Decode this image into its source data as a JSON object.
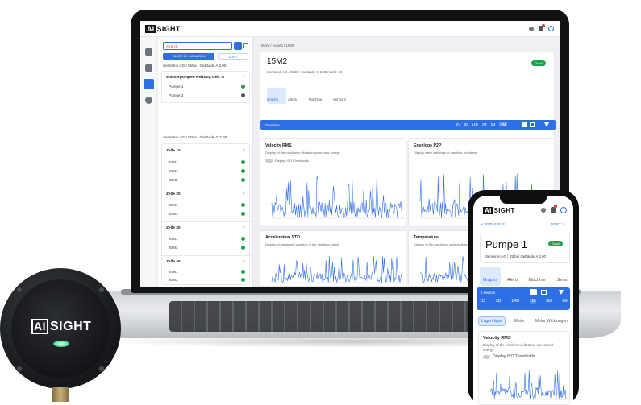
{
  "laptop": {
    "logo_box": "AI",
    "logo_text": "SIGHT",
    "sidebar": {
      "search_placeholder": "Search",
      "filter_location": "FILTER BY LOCATION",
      "sort": "SORT",
      "location1": "Senssron AG / Stäfa / Gebäude A 3.00",
      "group1_title": "Wasserpumpen Heizung Geb. A",
      "group1_items": [
        "Pumpe 1",
        "Pumpe 2"
      ],
      "location2": "Senssron AG / Stäfa / Gebäude C 2.00",
      "zones": [
        {
          "title": "Zelle 10",
          "items": [
            "20M1",
            "20M3",
            "20M5"
          ]
        },
        {
          "title": "Zelle 20",
          "items": [
            "20M1",
            "20M3"
          ]
        },
        {
          "title": "Zelle 30",
          "items": [
            "20M1",
            "20M3"
          ]
        },
        {
          "title": "Zelle 40",
          "items": [
            "20M1",
            "20M3"
          ]
        }
      ]
    },
    "main": {
      "breadcrumb": "Work / Assets / 15M2",
      "asset_title": "15M2",
      "asset_sub": "Senssron AG / Stäfa / Gebäude C 2.00 / Zelle 10",
      "status": "Good",
      "tabs": [
        "Graphs",
        "Alerts",
        "Machine",
        "Sensors"
      ],
      "bar_label": "Overview",
      "ranges": [
        "1h",
        "3D",
        "14D",
        "1M",
        "3M",
        "6M"
      ],
      "charts": [
        {
          "title": "Velocity RMS",
          "sub": "Display of the machine's vibration speed and energy",
          "toggle": "Display ISO Thresholds"
        },
        {
          "title": "Envelope P2P",
          "sub": "Display early warnings of machine problems"
        },
        {
          "title": "Acceleration STD",
          "sub": "Display of measured variation in the vibration signal"
        },
        {
          "title": "Temperature",
          "sub": "Display of the machine's surface temperature"
        }
      ]
    }
  },
  "sensor": {
    "logo_box": "AI",
    "logo_text": "SIGHT"
  },
  "phone": {
    "logo_box": "AI",
    "logo_text": "SIGHT",
    "previous": "< PREVIOUS",
    "next": "NEXT >",
    "title": "Pumpe 1",
    "status": "Good",
    "location": "Senssron AG / Stäfa / Gebäude A 3.00",
    "tabs": [
      "Graphs",
      "Alerts",
      "Machine",
      "Sens"
    ],
    "bar_label": "4 sensors",
    "ranges": [
      "1D",
      "3D",
      "14D",
      "1M",
      "3M",
      "6M"
    ],
    "segments": [
      "Lagerträger",
      "Motor",
      "Motor Wicklungen"
    ],
    "chart_title": "Velocity RMS",
    "chart_sub": "Display of the machine's vibration speed and energy",
    "toggle": "Display ISO Thresholds"
  }
}
